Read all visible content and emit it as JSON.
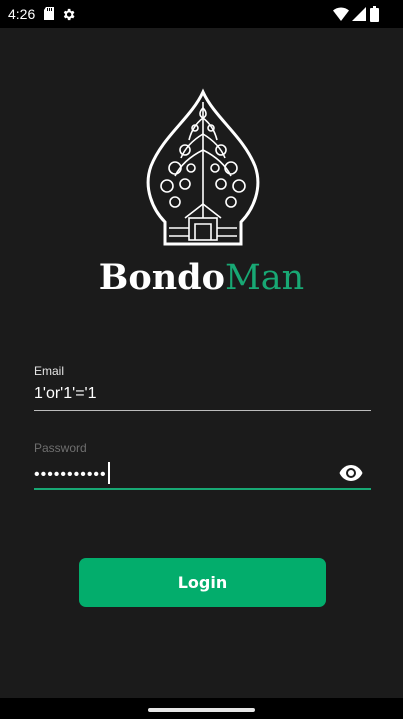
{
  "status_bar": {
    "time": "4:26",
    "left_icons": [
      "sd-card-icon",
      "settings-gear-icon"
    ],
    "right_icons": [
      "wifi-icon",
      "cellular-signal-icon",
      "battery-icon"
    ]
  },
  "brand": {
    "logo_icon": "wayang-gunungan-logo-icon",
    "name_part1": "Bondo",
    "name_part2": "Man",
    "name_part2_color": "#18a874"
  },
  "form": {
    "email": {
      "label": "Email",
      "value": "1'or'1'='1"
    },
    "password": {
      "label": "Password",
      "value": "•••••••••••",
      "visibility_icon": "eye-icon"
    },
    "login_label": "Login"
  },
  "colors": {
    "background": "#1b1b1b",
    "accent": "#03ad6c",
    "status_bar": "#000000"
  }
}
